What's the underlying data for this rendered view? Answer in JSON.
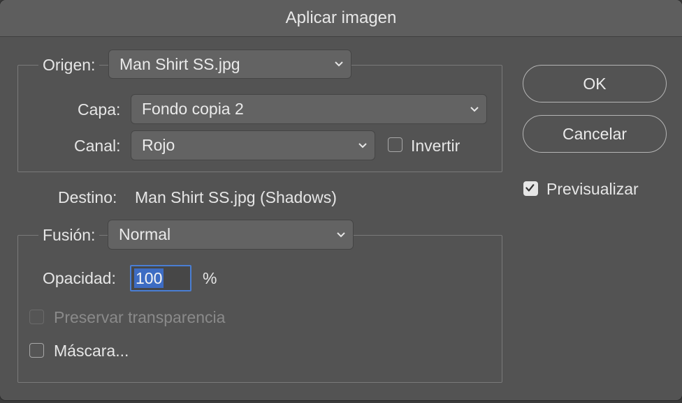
{
  "window": {
    "title": "Aplicar imagen"
  },
  "source": {
    "label": "Origen:",
    "value": "Man Shirt SS.jpg",
    "layer_label": "Capa:",
    "layer_value": "Fondo copia 2",
    "channel_label": "Canal:",
    "channel_value": "Rojo",
    "invert_label": "Invertir",
    "invert_checked": false
  },
  "target": {
    "label": "Destino:",
    "value": "Man Shirt SS.jpg (Shadows)"
  },
  "blending": {
    "label": "Fusión:",
    "value": "Normal",
    "opacity_label": "Opacidad:",
    "opacity_value": "100",
    "opacity_unit": "%",
    "preserve_label": "Preservar transparencia",
    "preserve_enabled": false,
    "mask_label": "Máscara...",
    "mask_checked": false
  },
  "buttons": {
    "ok_label": "OK",
    "cancel_label": "Cancelar"
  },
  "preview": {
    "label": "Previsualizar",
    "checked": true
  },
  "colors": {
    "dialog_bg": "#535353",
    "accent": "#3d6cc3"
  }
}
